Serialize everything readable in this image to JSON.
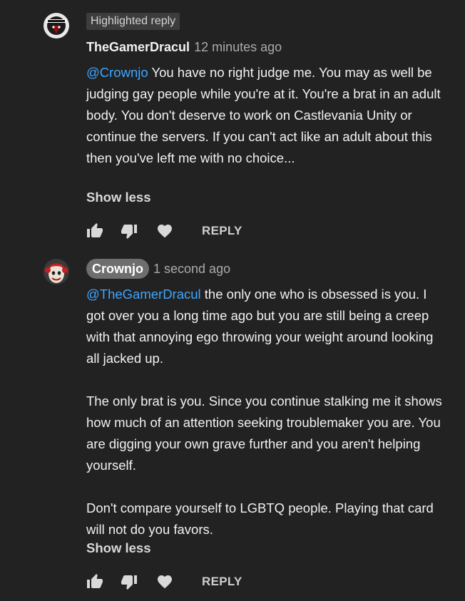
{
  "comments": [
    {
      "badge": "Highlighted reply",
      "author": "TheGamerDracul",
      "time": "12 minutes ago",
      "mention": "@Crownjo",
      "paragraphs": [
        " You have no right judge me. You may as well be judging gay people while you're at it. You're a brat in an adult body. You don't deserve to work on Castlevania Unity or continue the servers. If you can't act like an adult about this then you've left me with no choice..."
      ],
      "show_less": "Show less",
      "reply_label": "REPLY",
      "icons": [
        "like-icon",
        "dislike-icon",
        "heart-icon"
      ]
    },
    {
      "author": "Crownjo",
      "time": "1 second ago",
      "mention": "@TheGamerDracul",
      "paragraphs": [
        " the only one who is obsessed is you. I got over you a long time ago but you are still being a creep with that annoying ego throwing your weight around looking all jacked up.",
        "The only brat is you. Since you continue stalking me it shows how much of an attention seeking troublemaker you are. You are digging your own grave further and you aren't helping yourself.",
        "Don't compare yourself to LGBTQ people. Playing that card will not do you favors."
      ],
      "show_less": "Show less",
      "reply_label": "REPLY",
      "icons": [
        "like-icon",
        "dislike-icon",
        "heart-icon"
      ]
    }
  ],
  "colors": {
    "background": "#222222",
    "text": "#f1f1f1",
    "secondary": "#aaaaaa",
    "mention": "#3ea6ff",
    "badge_bg": "#3d3d3d",
    "chip_bg": "#6e6e6e"
  }
}
